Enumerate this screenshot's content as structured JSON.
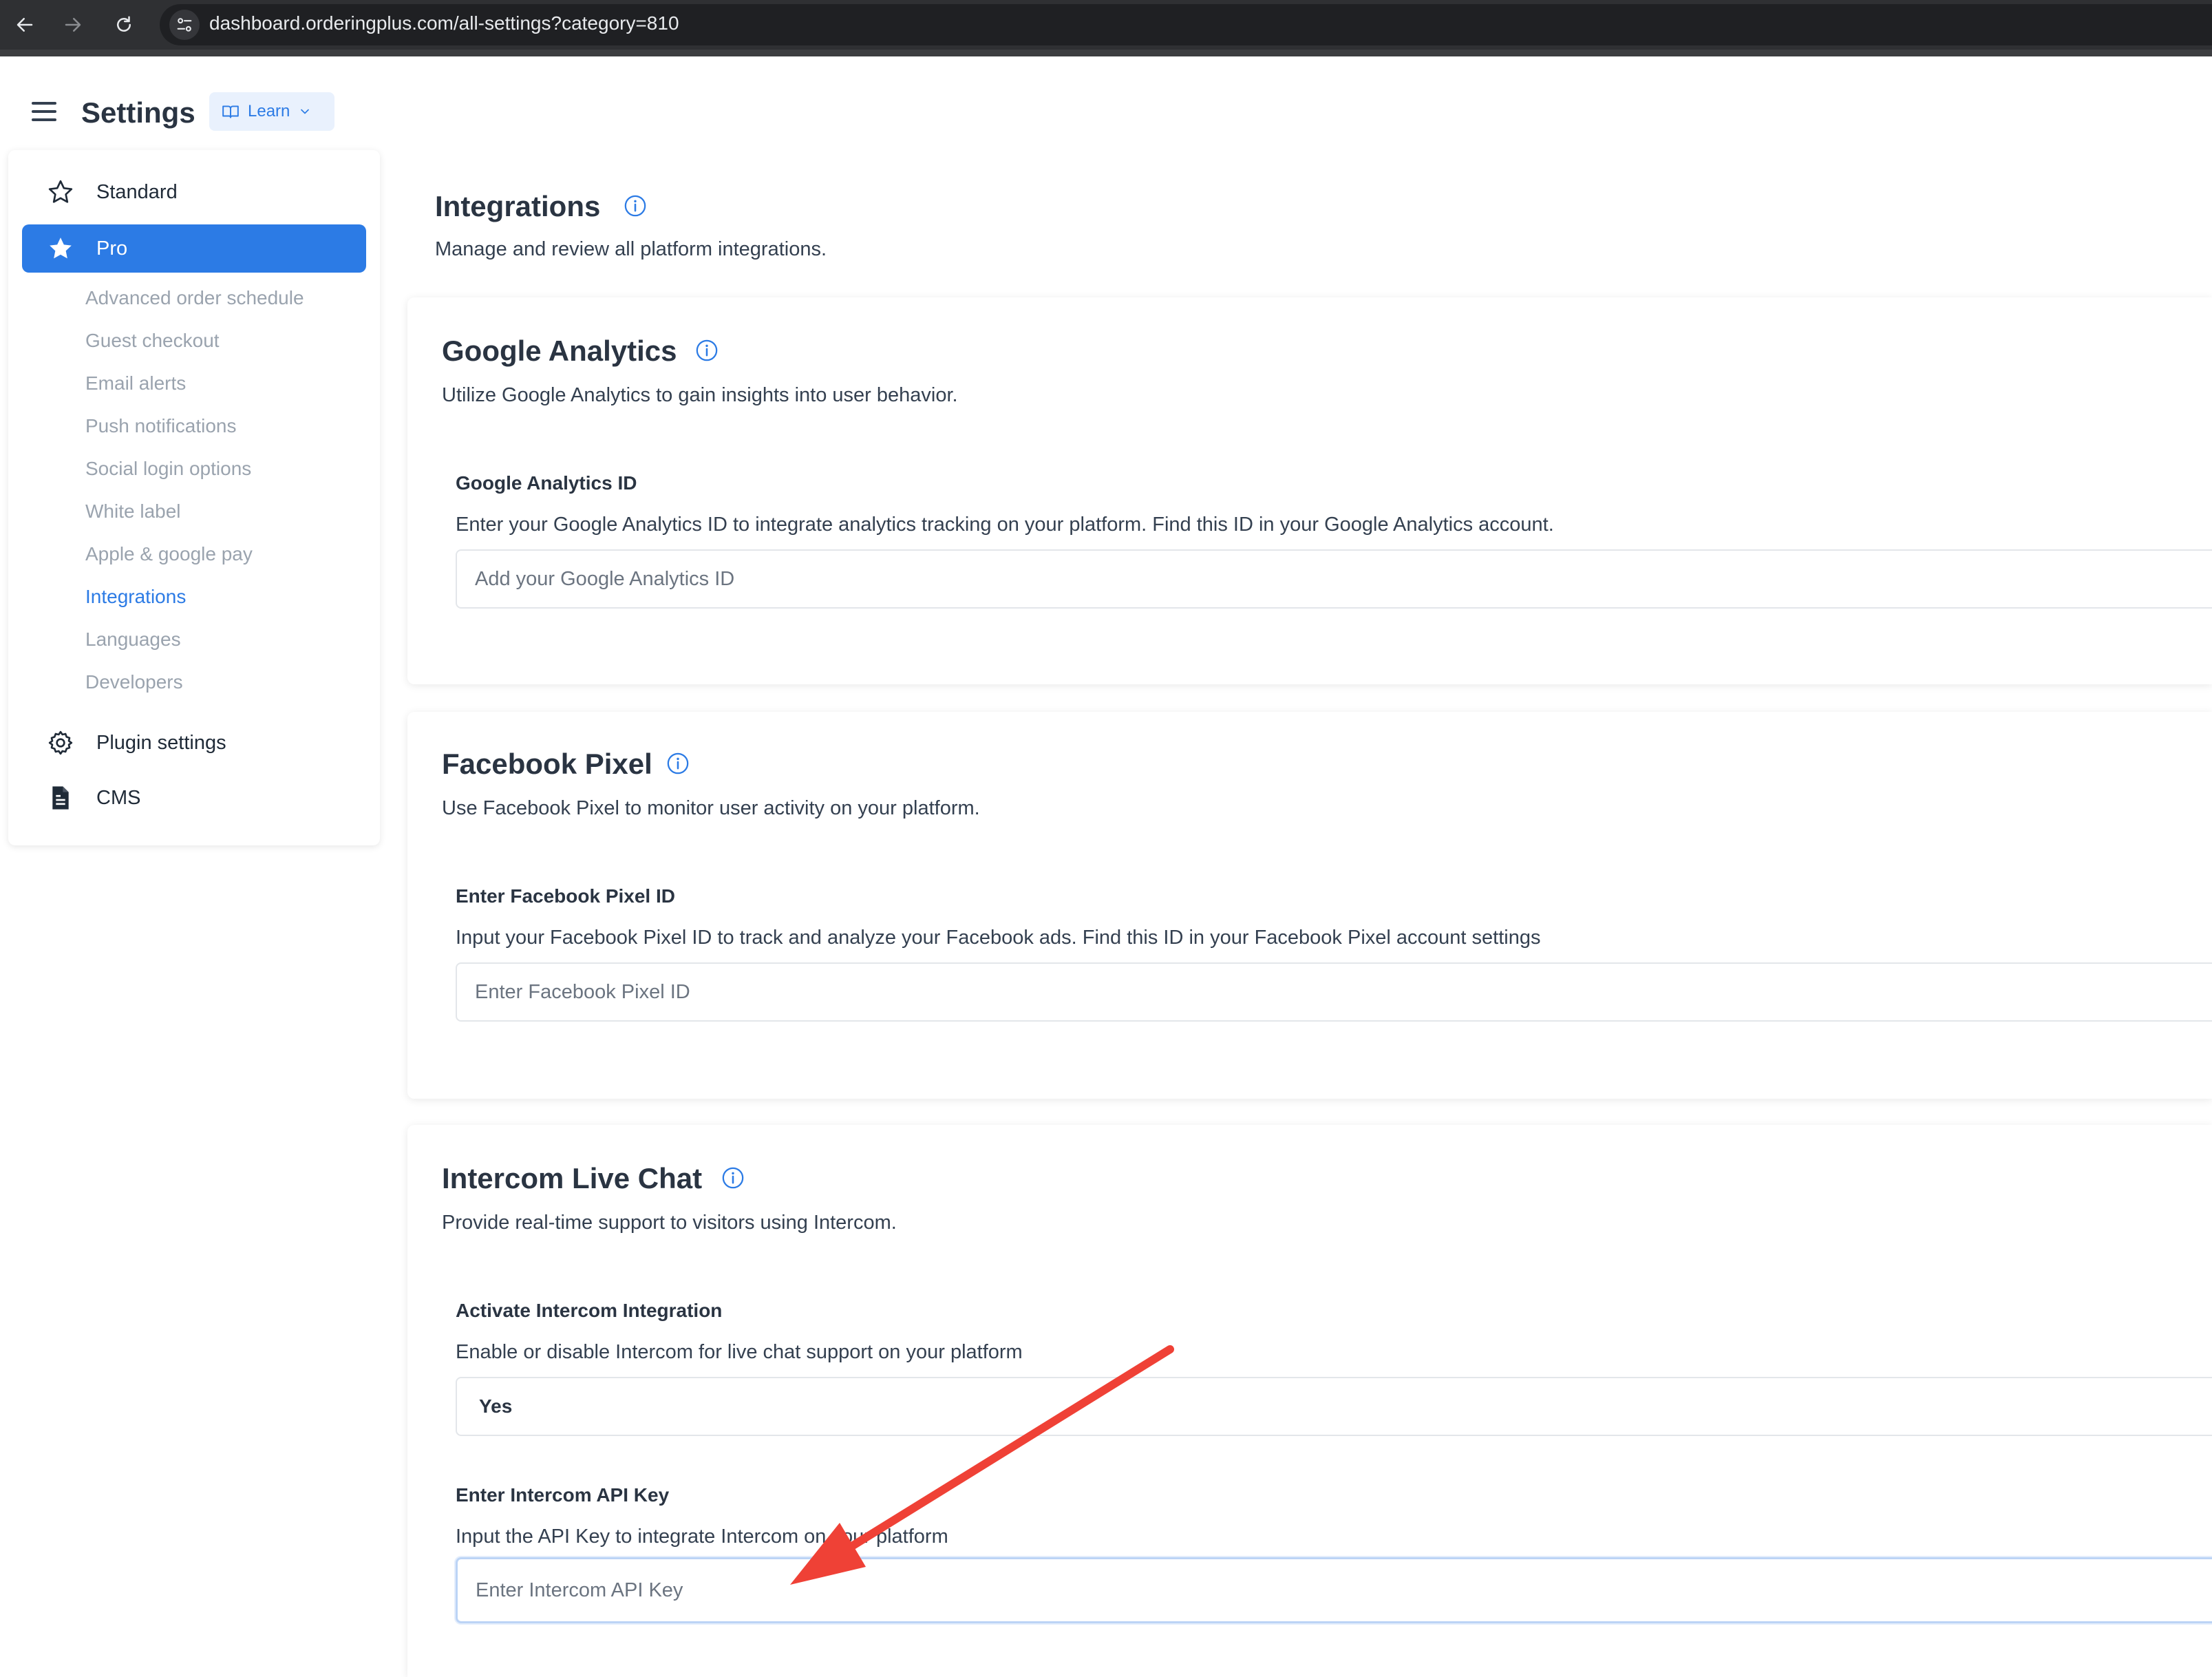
{
  "browser": {
    "url": "dashboard.orderingplus.com/all-settings?category=810"
  },
  "header": {
    "title": "Settings",
    "learn_label": "Learn"
  },
  "sidebar": {
    "standard": "Standard",
    "pro": "Pro",
    "pro_items": [
      "Advanced order schedule",
      "Guest checkout",
      "Email alerts",
      "Push notifications",
      "Social login options",
      "White label",
      "Apple & google pay",
      "Integrations",
      "Languages",
      "Developers"
    ],
    "plugin_settings": "Plugin settings",
    "cms": "CMS"
  },
  "page": {
    "heading": "Integrations",
    "description": "Manage and review all platform integrations."
  },
  "google_analytics": {
    "title": "Google Analytics",
    "description": "Utilize Google Analytics to gain insights into user behavior.",
    "field_label": "Google Analytics ID",
    "field_desc": "Enter your Google Analytics ID to integrate analytics tracking on your platform. Find this ID in your Google Analytics account.",
    "placeholder": "Add your Google Analytics ID"
  },
  "facebook_pixel": {
    "title": "Facebook Pixel",
    "description": "Use Facebook Pixel to monitor user activity on your platform.",
    "field_label": "Enter Facebook Pixel ID",
    "field_desc": "Input your Facebook Pixel ID to track and analyze your Facebook ads. Find this ID in your Facebook Pixel account settings",
    "placeholder": "Enter Facebook Pixel ID"
  },
  "intercom": {
    "title": "Intercom Live Chat",
    "description": "Provide real-time support to visitors using Intercom.",
    "activate_label": "Activate Intercom Integration",
    "activate_desc": "Enable or disable Intercom for live chat support on your platform",
    "activate_value": "Yes",
    "api_label": "Enter Intercom API Key",
    "api_desc": "Input the API Key to integrate Intercom on your platform",
    "api_placeholder": "Enter Intercom API Key"
  },
  "colors": {
    "accent": "#2c7be5",
    "annotation_arrow": "#ef4136"
  }
}
